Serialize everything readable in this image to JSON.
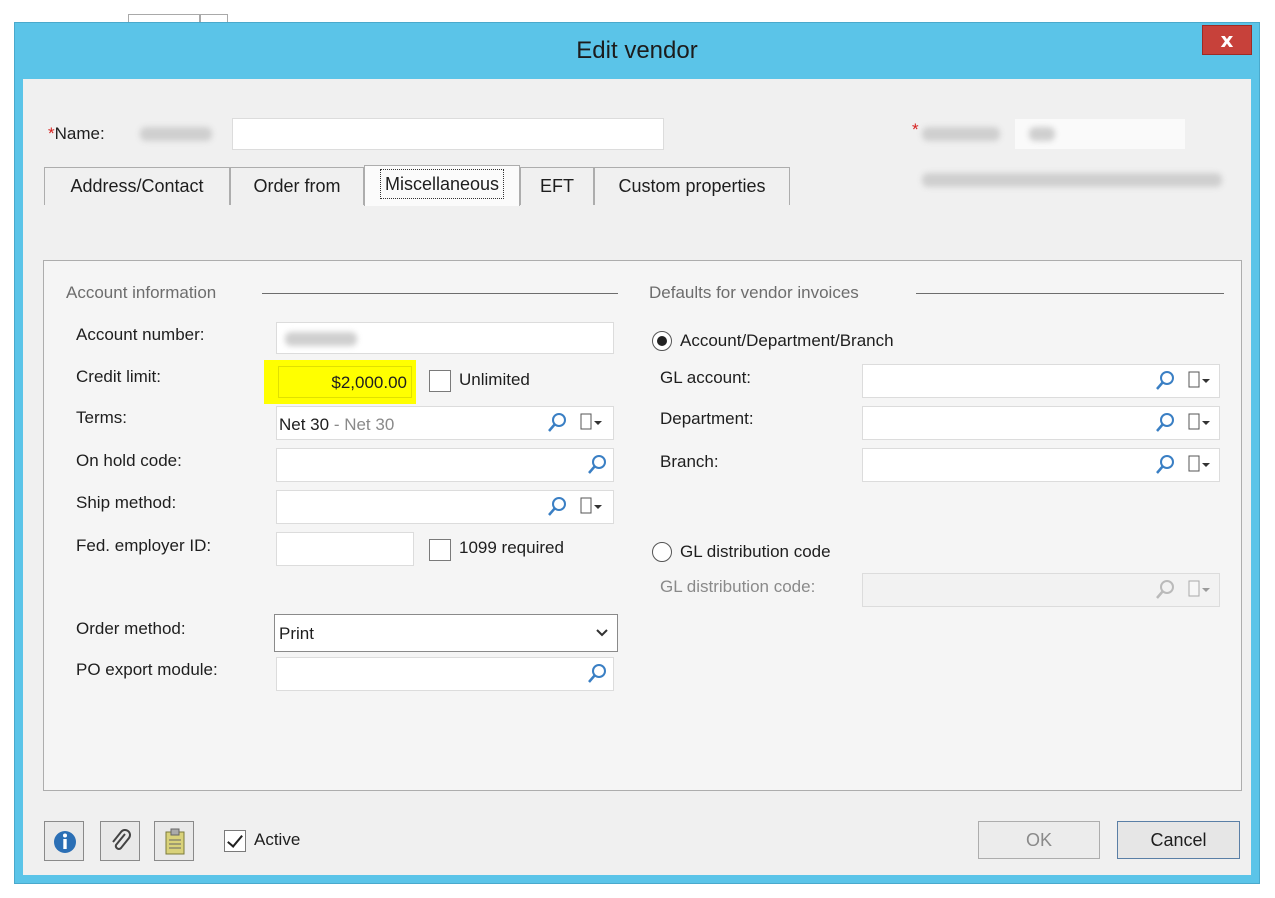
{
  "window": {
    "title": "Edit vendor",
    "close_label": "x"
  },
  "header": {
    "name_label": "Name:",
    "required_mark": "*",
    "name_value": ""
  },
  "tabs": [
    {
      "label": "Address/Contact"
    },
    {
      "label": "Order from"
    },
    {
      "label": "Miscellaneous"
    },
    {
      "label": "EFT"
    },
    {
      "label": "Custom properties"
    }
  ],
  "account_info": {
    "title": "Account information",
    "account_number_label": "Account number:",
    "credit_limit_label": "Credit limit:",
    "credit_limit_value": "$2,000.00",
    "unlimited_label": "Unlimited",
    "terms_label": "Terms:",
    "terms_value": "Net 30",
    "terms_sep": " - ",
    "terms_desc": "Net 30",
    "on_hold_label": "On hold code:",
    "on_hold_value": "",
    "ship_method_label": "Ship method:",
    "ship_method_value": "",
    "fed_id_label": "Fed. employer ID:",
    "fed_id_value": "",
    "required_1099_label": "1099 required",
    "order_method_label": "Order method:",
    "order_method_value": "Print",
    "po_export_label": "PO export module:",
    "po_export_value": ""
  },
  "defaults": {
    "title": "Defaults for vendor invoices",
    "radio_adb_label": "Account/Department/Branch",
    "gl_account_label": "GL account:",
    "department_label": "Department:",
    "branch_label": "Branch:",
    "radio_gl_dist_label": "GL distribution code",
    "gl_dist_code_label": "GL distribution code:"
  },
  "footer": {
    "active_label": "Active",
    "ok_label": "OK",
    "cancel_label": "Cancel"
  },
  "colors": {
    "title_bar": "#5bc4e8",
    "close_button": "#c7413a",
    "highlight": "#ffff00"
  }
}
